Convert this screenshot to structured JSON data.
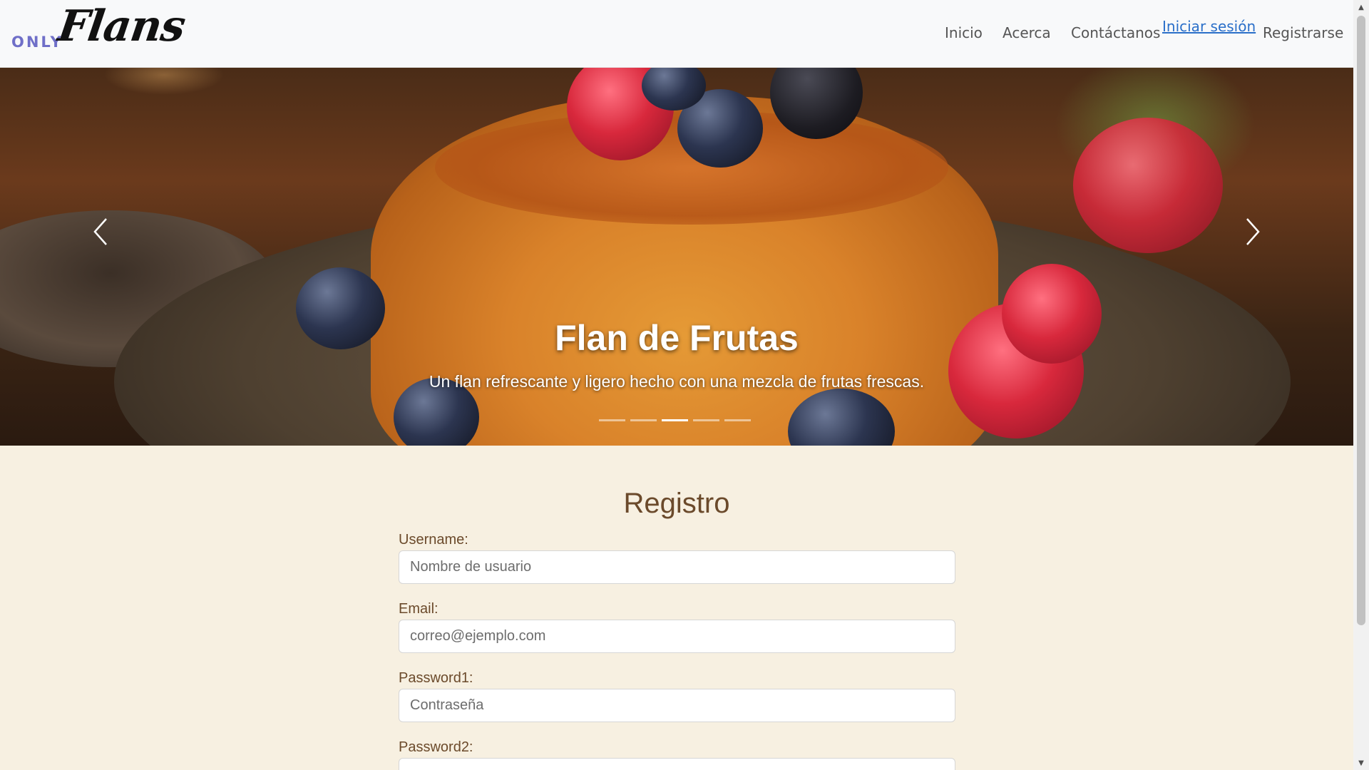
{
  "brand": {
    "only": "ONLY",
    "name": "Flans"
  },
  "nav": {
    "inicio": "Inicio",
    "acerca": "Acerca",
    "contacto": "Contáctanos",
    "login": "Iniciar sesión",
    "register": "Registrarse"
  },
  "carousel": {
    "title": "Flan de Frutas",
    "subtitle": "Un flan refrescante y ligero hecho con una mezcla de frutas frescas.",
    "slide_count": 5,
    "active_index": 2
  },
  "form": {
    "title": "Registro",
    "username_label": "Username:",
    "username_placeholder": "Nombre de usuario",
    "email_label": "Email:",
    "email_placeholder": "correo@ejemplo.com",
    "password1_label": "Password1:",
    "password1_placeholder": "Contraseña",
    "password2_label": "Password2:"
  },
  "colors": {
    "page_bg": "#f7f0e1",
    "navbar_bg": "#f8f9fa",
    "brand_accent": "#6f6fc8",
    "form_text": "#6b4a2b",
    "link_blue": "#2a6fc9"
  },
  "icons": {
    "prev": "chevron-left-icon",
    "next": "chevron-right-icon",
    "scroll_up": "arrow-up-icon",
    "scroll_down": "arrow-down-icon"
  }
}
